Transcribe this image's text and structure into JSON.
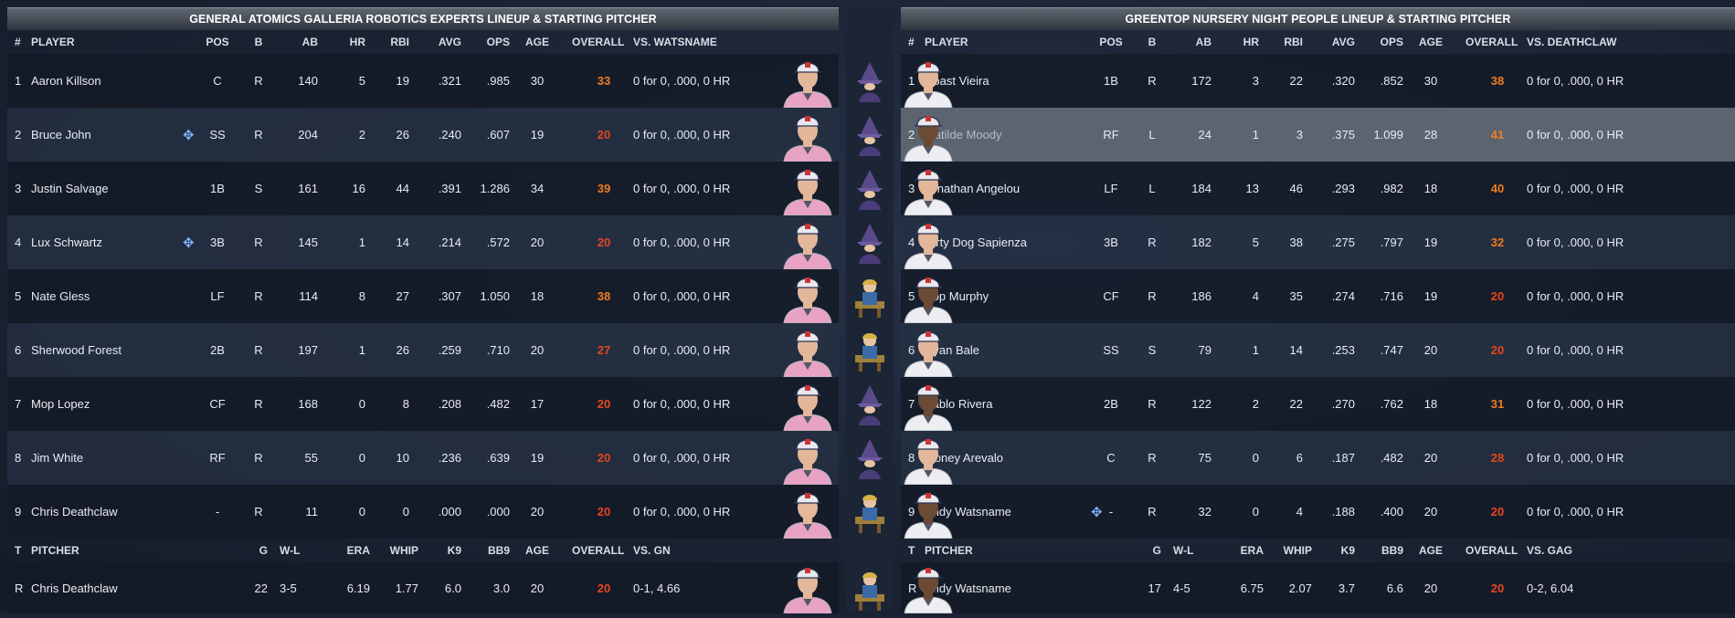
{
  "colors": {
    "ovr_low": "#e8451f",
    "ovr_mid": "#f07d1f",
    "pink_jersey": "#e8a3c4",
    "white_jersey": "#eceef2",
    "accent_plus": "#7fb2ff"
  },
  "left": {
    "title": "GENERAL ATOMICS GALLERIA ROBOTICS EXPERTS LINEUP & STARTING PITCHER",
    "headers": {
      "num": "#",
      "player": "PLAYER",
      "pos": "POS",
      "b": "B",
      "ab": "AB",
      "hr": "HR",
      "rbi": "RBI",
      "avg": "AVG",
      "ops": "OPS",
      "age": "AGE",
      "overall": "OVERALL",
      "vs": "VS. WATSNAME"
    },
    "rows": [
      {
        "num": "1",
        "name": "Aaron Killson",
        "pos": "C",
        "b": "R",
        "ab": "140",
        "hr": "5",
        "rbi": "19",
        "avg": ".321",
        "ops": ".985",
        "age": "30",
        "overall": "33",
        "vs": "0 for 0, .000, 0 HR"
      },
      {
        "num": "2",
        "name": "Bruce John",
        "pos": "SS",
        "b": "R",
        "ab": "204",
        "hr": "2",
        "rbi": "26",
        "avg": ".240",
        "ops": ".607",
        "age": "19",
        "overall": "20",
        "vs": "0 for 0, .000, 0 HR"
      },
      {
        "num": "3",
        "name": "Justin Salvage",
        "pos": "1B",
        "b": "S",
        "ab": "161",
        "hr": "16",
        "rbi": "44",
        "avg": ".391",
        "ops": "1.286",
        "age": "34",
        "overall": "39",
        "vs": "0 for 0, .000, 0 HR"
      },
      {
        "num": "4",
        "name": "Lux Schwartz",
        "pos": "3B",
        "b": "R",
        "ab": "145",
        "hr": "1",
        "rbi": "14",
        "avg": ".214",
        "ops": ".572",
        "age": "20",
        "overall": "20",
        "vs": "0 for 0, .000, 0 HR"
      },
      {
        "num": "5",
        "name": "Nate Gless",
        "pos": "LF",
        "b": "R",
        "ab": "114",
        "hr": "8",
        "rbi": "27",
        "avg": ".307",
        "ops": "1.050",
        "age": "18",
        "overall": "38",
        "vs": "0 for 0, .000, 0 HR"
      },
      {
        "num": "6",
        "name": "Sherwood Forest",
        "pos": "2B",
        "b": "R",
        "ab": "197",
        "hr": "1",
        "rbi": "26",
        "avg": ".259",
        "ops": ".710",
        "age": "20",
        "overall": "27",
        "vs": "0 for 0, .000, 0 HR"
      },
      {
        "num": "7",
        "name": "Mop Lopez",
        "pos": "CF",
        "b": "R",
        "ab": "168",
        "hr": "0",
        "rbi": "8",
        "avg": ".208",
        "ops": ".482",
        "age": "17",
        "overall": "20",
        "vs": "0 for 0, .000, 0 HR"
      },
      {
        "num": "8",
        "name": "Jim White",
        "pos": "RF",
        "b": "R",
        "ab": "55",
        "hr": "0",
        "rbi": "10",
        "avg": ".236",
        "ops": ".639",
        "age": "19",
        "overall": "20",
        "vs": "0 for 0, .000, 0 HR"
      },
      {
        "num": "9",
        "name": "Chris Deathclaw",
        "pos": "-",
        "b": "R",
        "ab": "11",
        "hr": "0",
        "rbi": "0",
        "avg": ".000",
        "ops": ".000",
        "age": "20",
        "overall": "20",
        "vs": "0 for 0, .000, 0 HR"
      }
    ],
    "pitcher_headers": {
      "t": "T",
      "pitcher": "PITCHER",
      "g": "G",
      "wl": "W-L",
      "era": "ERA",
      "whip": "WHIP",
      "k9": "K9",
      "bb9": "BB9",
      "age": "AGE",
      "overall": "OVERALL",
      "vs": "VS. GN"
    },
    "pitcher": {
      "t": "R",
      "name": "Chris Deathclaw",
      "g": "22",
      "wl": "3-5",
      "era": "6.19",
      "whip": "1.77",
      "k9": "6.0",
      "bb9": "3.0",
      "age": "20",
      "overall": "20",
      "vs": "0-1, 4.66"
    }
  },
  "right": {
    "title": "GREENTOP NURSERY NIGHT PEOPLE LINEUP & STARTING PITCHER",
    "headers": {
      "num": "#",
      "player": "PLAYER",
      "pos": "POS",
      "b": "B",
      "ab": "AB",
      "hr": "HR",
      "rbi": "RBI",
      "avg": "AVG",
      "ops": "OPS",
      "age": "AGE",
      "overall": "OVERALL",
      "vs": "VS. DEATHCLAW"
    },
    "rows": [
      {
        "num": "1",
        "name": "Coast Vieira",
        "pos": "1B",
        "b": "R",
        "ab": "172",
        "hr": "3",
        "rbi": "22",
        "avg": ".320",
        "ops": ".852",
        "age": "30",
        "overall": "38",
        "vs": "0 for 0, .000, 0 HR"
      },
      {
        "num": "2",
        "name": "Matilde Moody",
        "pos": "RF",
        "b": "L",
        "ab": "24",
        "hr": "1",
        "rbi": "3",
        "avg": ".375",
        "ops": "1.099",
        "age": "28",
        "overall": "41",
        "vs": "0 for 0, .000, 0 HR"
      },
      {
        "num": "3",
        "name": "Jonathan Angelou",
        "pos": "LF",
        "b": "L",
        "ab": "184",
        "hr": "13",
        "rbi": "46",
        "avg": ".293",
        "ops": ".982",
        "age": "18",
        "overall": "40",
        "vs": "0 for 0, .000, 0 HR"
      },
      {
        "num": "4",
        "name": "Dirty Dog Sapienza",
        "pos": "3B",
        "b": "R",
        "ab": "182",
        "hr": "5",
        "rbi": "38",
        "avg": ".275",
        "ops": ".797",
        "age": "19",
        "overall": "32",
        "vs": "0 for 0, .000, 0 HR"
      },
      {
        "num": "5",
        "name": "Pop Murphy",
        "pos": "CF",
        "b": "R",
        "ab": "186",
        "hr": "4",
        "rbi": "35",
        "avg": ".274",
        "ops": ".716",
        "age": "19",
        "overall": "20",
        "vs": "0 for 0, .000, 0 HR"
      },
      {
        "num": "6",
        "name": "Ryan Bale",
        "pos": "SS",
        "b": "S",
        "ab": "79",
        "hr": "1",
        "rbi": "14",
        "avg": ".253",
        "ops": ".747",
        "age": "20",
        "overall": "20",
        "vs": "0 for 0, .000, 0 HR"
      },
      {
        "num": "7",
        "name": "Pablo Rivera",
        "pos": "2B",
        "b": "R",
        "ab": "122",
        "hr": "2",
        "rbi": "22",
        "avg": ".270",
        "ops": ".762",
        "age": "18",
        "overall": "31",
        "vs": "0 for 0, .000, 0 HR"
      },
      {
        "num": "8",
        "name": "Money Arevalo",
        "pos": "C",
        "b": "R",
        "ab": "75",
        "hr": "0",
        "rbi": "6",
        "avg": ".187",
        "ops": ".482",
        "age": "20",
        "overall": "28",
        "vs": "0 for 0, .000, 0 HR"
      },
      {
        "num": "9",
        "name": "Andy Watsname",
        "pos": "-",
        "b": "R",
        "ab": "32",
        "hr": "0",
        "rbi": "4",
        "avg": ".188",
        "ops": ".400",
        "age": "20",
        "overall": "20",
        "vs": "0 for 0, .000, 0 HR"
      }
    ],
    "pitcher_headers": {
      "t": "T",
      "pitcher": "PITCHER",
      "g": "G",
      "wl": "W-L",
      "era": "ERA",
      "whip": "WHIP",
      "k9": "K9",
      "bb9": "BB9",
      "age": "AGE",
      "overall": "OVERALL",
      "vs": "VS. GAG"
    },
    "pitcher": {
      "t": "R",
      "name": "Andy Watsname",
      "g": "17",
      "wl": "4-5",
      "era": "6.75",
      "whip": "2.07",
      "k9": "3.7",
      "bb9": "6.6",
      "age": "20",
      "overall": "20",
      "vs": "0-2, 6.04"
    }
  }
}
